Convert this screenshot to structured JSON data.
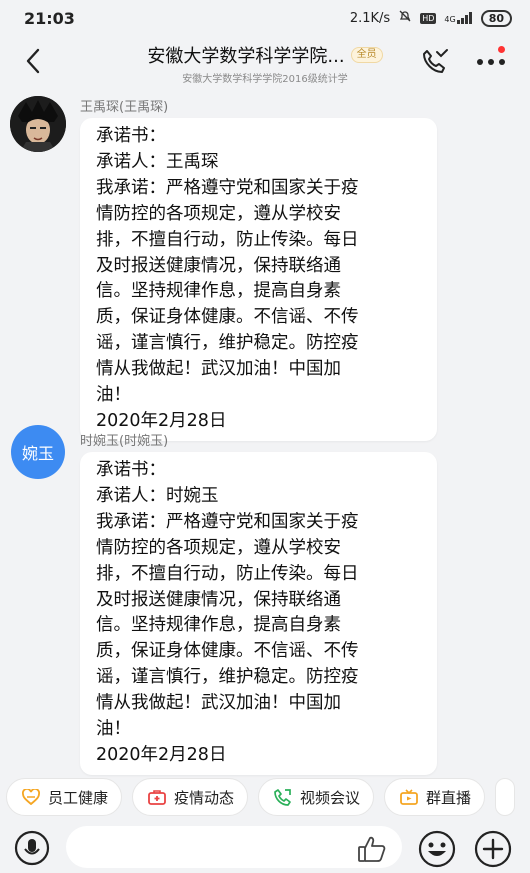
{
  "status_bar": {
    "time": "21:03",
    "speed": "2.1K/s",
    "hd": "HD",
    "network": "4G",
    "battery": "80"
  },
  "header": {
    "title": "安徽大学数学科学学院...",
    "badge": "全员",
    "subtitle": "安徽大学数学科学学院2016级统计学"
  },
  "messages": [
    {
      "sender": "王禹琛(王禹琛)",
      "lines": [
        "承诺书：",
        "承诺人：王禹琛",
        "我承诺：严格遵守党和国家关于疫",
        "情防控的各项规定，遵从学校安",
        "排，不擅自行动，防止传染。每日",
        "及时报送健康情况，保持联络通",
        "信。坚持规律作息，提高自身素",
        "质，保证身体健康。不信谣、不传",
        "谣，谨言慎行，维护稳定。防控疫",
        "情从我做起！武汉加油！中国加",
        "油！",
        "2020年2月28日"
      ]
    },
    {
      "sender": "时婉玉(时婉玉)",
      "avatar_text": "婉玉",
      "lines": [
        "承诺书：",
        "承诺人：时婉玉",
        "我承诺：严格遵守党和国家关于疫",
        "情防控的各项规定，遵从学校安",
        "排，不擅自行动，防止传染。每日",
        "及时报送健康情况，保持联络通",
        "信。坚持规律作息，提高自身素",
        "质，保证身体健康。不信谣、不传",
        "谣，谨言慎行，维护稳定。防控疫",
        "情从我做起！武汉加油！中国加",
        "油！",
        "2020年2月28日"
      ]
    }
  ],
  "quick_actions": [
    {
      "label": "员工健康",
      "icon": "heart-icon",
      "color": "#f5a623"
    },
    {
      "label": "疫情动态",
      "icon": "medical-kit-icon",
      "color": "#e94343"
    },
    {
      "label": "视频会议",
      "icon": "video-call-icon",
      "color": "#2bb05a"
    },
    {
      "label": "群直播",
      "icon": "live-tv-icon",
      "color": "#f5a623"
    }
  ],
  "input": {
    "placeholder": ""
  },
  "colors": {
    "background": "#f2f3f5",
    "avatar_blue": "#3d8bf2",
    "notification_red": "#ff3333"
  }
}
